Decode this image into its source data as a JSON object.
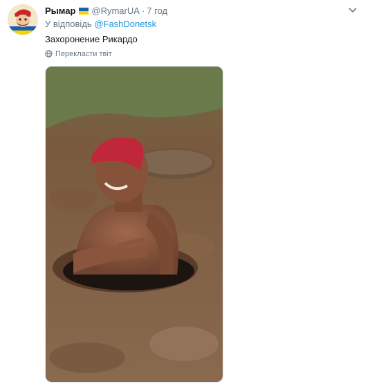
{
  "tweet": {
    "author_name": "Рымар",
    "handle": "@RymarUA",
    "separator": "·",
    "time": "7 год",
    "reply_prefix": "У відповідь",
    "reply_to": "@FashDonetsk",
    "text": "Захоронение Рикардо",
    "translate_label": "Перекласти твіт"
  },
  "icons": {
    "flag": "ukraine-flag-icon",
    "menu": "chevron-down-icon",
    "translate": "globe-icon"
  },
  "colors": {
    "link": "#1b95e0",
    "secondary_text": "#657786",
    "primary_text": "#14171a",
    "flag_blue": "#1a5fb4",
    "flag_yellow": "#f5d400"
  }
}
